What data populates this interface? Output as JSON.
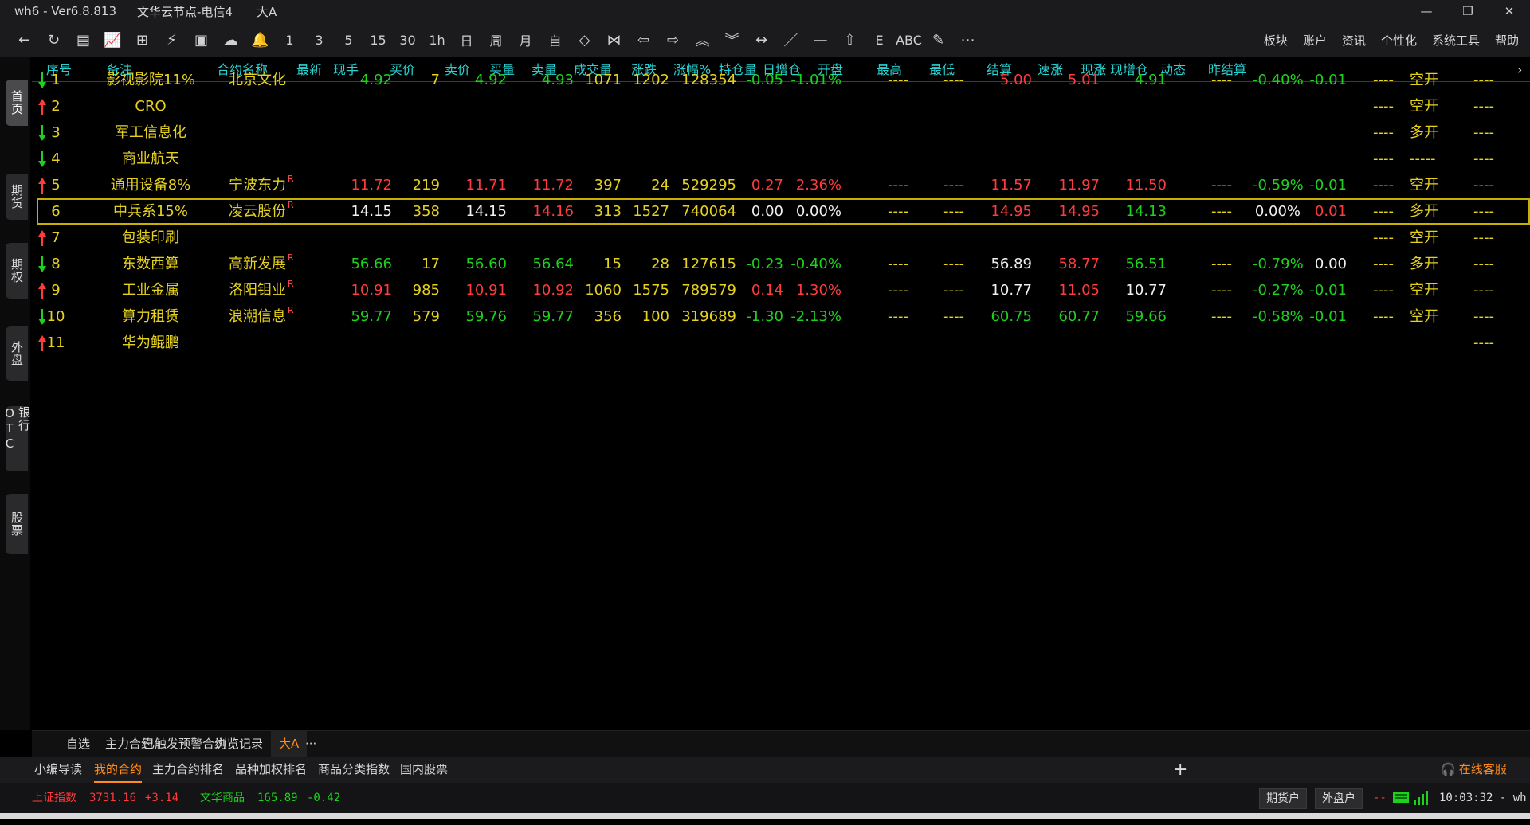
{
  "window": {
    "app_name": "wh6  -  Ver6.8.813",
    "server": "文华云节点-电信4",
    "page": "大A",
    "minimize": "—",
    "restore": "❐",
    "close": "✕"
  },
  "toolbar": {
    "icons": [
      "back-icon",
      "refresh-icon",
      "list-icon",
      "line-chart-icon",
      "candlestick-icon",
      "kline-edit-icon",
      "quote-icon",
      "cloud-icon",
      "bell-icon",
      "1",
      "3",
      "5",
      "15",
      "30",
      "1h",
      "日",
      "周",
      "月",
      "自",
      "expand-icon",
      "compress-icon",
      "left-icon",
      "right-icon",
      "up-double-icon",
      "down-double-icon",
      "fit-icon",
      "pen-line-icon",
      "horizontal-line-icon",
      "shift-icon",
      "E",
      "ABC",
      "eraser-icon",
      "more-icon"
    ],
    "glyphs": [
      "←",
      "↻",
      "▤",
      "📈",
      "⊞",
      "⚡",
      "▣",
      "☁",
      "🔔",
      "1",
      "3",
      "5",
      "15",
      "30",
      "1h",
      "日",
      "周",
      "月",
      "自",
      "◇",
      "⋈",
      "⇦",
      "⇨",
      "︽",
      "︾",
      "↔",
      "／",
      "—",
      "⇧",
      "E",
      "ABC",
      "✎",
      "⋯"
    ],
    "menu": [
      "板块",
      "账户",
      "资讯",
      "个性化",
      "系统工具",
      "帮助"
    ]
  },
  "left_tabs": [
    {
      "label": "首页"
    },
    {
      "label": "期货"
    },
    {
      "label": "期权"
    },
    {
      "label": "外盘"
    },
    {
      "label": "银行OTC"
    },
    {
      "label": "股票"
    }
  ],
  "table": {
    "headers": [
      "序号",
      "备注",
      "合约名称",
      "最新",
      "现手",
      "买价",
      "卖价",
      "买量",
      "卖量",
      "成交量",
      "涨跌",
      "涨幅%",
      "持仓量",
      "日增仓",
      "开盘",
      "最高",
      "最低",
      "结算",
      "速涨",
      "现涨",
      "现增仓",
      "动态",
      "昨结算"
    ],
    "scroll_right": "›",
    "rows": [
      {
        "dir": "down",
        "no": "1",
        "note": "影视影院11%",
        "name": "北京文化",
        "r": false,
        "last": "4.92",
        "cur": "7",
        "bid": "4.92",
        "ask": "4.93",
        "bidv": "1071",
        "askv": "1202",
        "vol": "128354",
        "chg": "-0.05",
        "pct": "-1.01%",
        "oi": "----",
        "doi": "----",
        "open": "5.00",
        "high": "5.01",
        "low": "4.91",
        "settle": "----",
        "speed": "-0.40%",
        "nowchg": "-0.01",
        "nowoi": "----",
        "dyn": "空开",
        "pset": "----"
      },
      {
        "dir": "up",
        "no": "2",
        "note": "CRO",
        "name": "",
        "r": false,
        "last": "",
        "cur": "",
        "bid": "",
        "ask": "",
        "bidv": "",
        "askv": "",
        "vol": "",
        "chg": "",
        "pct": "",
        "oi": "",
        "doi": "",
        "open": "",
        "high": "",
        "low": "",
        "settle": "",
        "speed": "",
        "nowchg": "",
        "nowoi": "----",
        "dyn": "空开",
        "pset": "----"
      },
      {
        "dir": "down",
        "no": "3",
        "note": "军工信息化",
        "name": "",
        "r": false,
        "last": "",
        "cur": "",
        "bid": "",
        "ask": "",
        "bidv": "",
        "askv": "",
        "vol": "",
        "chg": "",
        "pct": "",
        "oi": "",
        "doi": "",
        "open": "",
        "high": "",
        "low": "",
        "settle": "",
        "speed": "",
        "nowchg": "",
        "nowoi": "----",
        "dyn": "多开",
        "pset": "----"
      },
      {
        "dir": "down",
        "no": "4",
        "note": "商业航天",
        "name": "",
        "r": false,
        "last": "",
        "cur": "",
        "bid": "",
        "ask": "",
        "bidv": "",
        "askv": "",
        "vol": "",
        "chg": "",
        "pct": "",
        "oi": "",
        "doi": "",
        "open": "",
        "high": "",
        "low": "",
        "settle": "",
        "speed": "",
        "nowchg": "",
        "nowoi": "----",
        "dyn": "-----",
        "pset": "----"
      },
      {
        "dir": "up",
        "no": "5",
        "note": "通用设备8%",
        "name": "宁波东力",
        "r": true,
        "last": "11.72",
        "cur": "219",
        "bid": "11.71",
        "ask": "11.72",
        "bidv": "397",
        "askv": "24",
        "vol": "529295",
        "chg": "0.27",
        "pct": "2.36%",
        "oi": "----",
        "doi": "----",
        "open": "11.57",
        "high": "11.97",
        "low": "11.50",
        "settle": "----",
        "speed": "-0.59%",
        "nowchg": "-0.01",
        "nowoi": "----",
        "dyn": "空开",
        "pset": "----"
      },
      {
        "dir": "",
        "no": "6",
        "note": "中兵系15%",
        "name": "凌云股份",
        "r": true,
        "last": "14.15",
        "cur": "358",
        "bid": "14.15",
        "ask": "14.16",
        "bidv": "313",
        "askv": "1527",
        "vol": "740064",
        "chg": "0.00",
        "pct": "0.00%",
        "oi": "----",
        "doi": "----",
        "open": "14.95",
        "high": "14.95",
        "low": "14.13",
        "settle": "----",
        "speed": "0.00%",
        "nowchg": "0.01",
        "nowoi": "----",
        "dyn": "多开",
        "pset": "----"
      },
      {
        "dir": "up",
        "no": "7",
        "note": "包装印刷",
        "name": "",
        "r": false,
        "last": "",
        "cur": "",
        "bid": "",
        "ask": "",
        "bidv": "",
        "askv": "",
        "vol": "",
        "chg": "",
        "pct": "",
        "oi": "",
        "doi": "",
        "open": "",
        "high": "",
        "low": "",
        "settle": "",
        "speed": "",
        "nowchg": "",
        "nowoi": "----",
        "dyn": "空开",
        "pset": "----"
      },
      {
        "dir": "down",
        "no": "8",
        "note": "东数西算",
        "name": "高新发展",
        "r": true,
        "last": "56.66",
        "cur": "17",
        "bid": "56.60",
        "ask": "56.64",
        "bidv": "15",
        "askv": "28",
        "vol": "127615",
        "chg": "-0.23",
        "pct": "-0.40%",
        "oi": "----",
        "doi": "----",
        "open": "56.89",
        "high": "58.77",
        "low": "56.51",
        "settle": "----",
        "speed": "-0.79%",
        "nowchg": "0.00",
        "nowoi": "----",
        "dyn": "多开",
        "pset": "----"
      },
      {
        "dir": "up",
        "no": "9",
        "note": "工业金属",
        "name": "洛阳钼业",
        "r": true,
        "last": "10.91",
        "cur": "985",
        "bid": "10.91",
        "ask": "10.92",
        "bidv": "1060",
        "askv": "1575",
        "vol": "789579",
        "chg": "0.14",
        "pct": "1.30%",
        "oi": "----",
        "doi": "----",
        "open": "10.77",
        "high": "11.05",
        "low": "10.77",
        "settle": "----",
        "speed": "-0.27%",
        "nowchg": "-0.01",
        "nowoi": "----",
        "dyn": "空开",
        "pset": "----"
      },
      {
        "dir": "down",
        "no": "10",
        "note": "算力租赁",
        "name": "浪潮信息",
        "r": true,
        "last": "59.77",
        "cur": "579",
        "bid": "59.76",
        "ask": "59.77",
        "bidv": "356",
        "askv": "100",
        "vol": "319689",
        "chg": "-1.30",
        "pct": "-2.13%",
        "oi": "----",
        "doi": "----",
        "open": "60.75",
        "high": "60.77",
        "low": "59.66",
        "settle": "----",
        "speed": "-0.58%",
        "nowchg": "-0.01",
        "nowoi": "----",
        "dyn": "空开",
        "pset": "----"
      },
      {
        "dir": "up",
        "no": "11",
        "note": "华为鲲鹏",
        "name": "",
        "r": false,
        "last": "",
        "cur": "",
        "bid": "",
        "ask": "",
        "bidv": "",
        "askv": "",
        "vol": "",
        "chg": "",
        "pct": "",
        "oi": "",
        "doi": "",
        "open": "",
        "high": "",
        "low": "",
        "settle": "",
        "speed": "",
        "nowchg": "",
        "nowoi": "",
        "dyn": "",
        "pset": "----"
      }
    ],
    "r_mark": "R",
    "colors": {
      "up": "#ff3b3b",
      "down": "#1fd11f",
      "flat": "#f0f0f0",
      "yellow": "#e6d21e",
      "header": "#2ad1d1"
    }
  },
  "sheet_tabs": [
    "自选",
    "主力合约",
    "已触发预警合约",
    "浏览记录",
    "大A",
    "···"
  ],
  "sheet_tabs_active": 4,
  "bottom_tabs": [
    "小编导读",
    "我的合约",
    "主力合约排名",
    "品种加权排名",
    "商品分类指数",
    "国内股票"
  ],
  "bottom_tabs_active": 1,
  "bottom_add": "+",
  "service": "在线客服",
  "status": {
    "idx1_name": "上证指数",
    "idx1_value": "3731.16",
    "idx1_change": "+3.14",
    "idx2_name": "文华商品",
    "idx2_value": "165.89",
    "idx2_change": "-0.42",
    "btn_futures": "期货户",
    "btn_foreign": "外盘户",
    "dash": "--",
    "clock": "10:03:32 - wh"
  }
}
